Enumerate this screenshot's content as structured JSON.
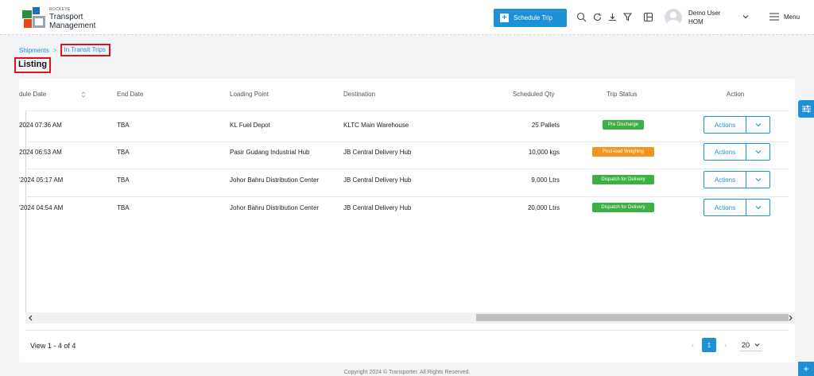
{
  "brand": {
    "small": "ROCKEYE",
    "line1": "Transport",
    "line2": "Management"
  },
  "header": {
    "schedule_label": "Schedule Trip",
    "user_name": "Demo User",
    "user_role": "HOM",
    "menu_label": "Menu"
  },
  "breadcrumb": {
    "parent": "Shipments",
    "sep": ">",
    "current": "In Transit Trips"
  },
  "page_title": "Listing",
  "table": {
    "columns": [
      "dule Date",
      "End Date",
      "Loading Point",
      "Destination",
      "Scheduled Qty",
      "Trip Status",
      "Action"
    ],
    "rows": [
      {
        "start": "2024 07:36 AM",
        "end": "TBA",
        "loading": "KL Fuel Depot",
        "destination": "KLTC Main Warehouse",
        "qty": "25 Pallets",
        "status": "Pre Discharge",
        "action": "Actions"
      },
      {
        "start": "2024 06:53 AM",
        "end": "TBA",
        "loading": "Pasir Gudang Industrial Hub",
        "destination": "JB Central Delivery Hub",
        "qty": "10,000 kgs",
        "status": "Post-load Weighing",
        "action": "Actions"
      },
      {
        "start": "'2024 05:17 AM",
        "end": "TBA",
        "loading": "Johor Bahru Distribution Center",
        "destination": "JB Central Delivery Hub",
        "qty": "9,000 Ltrs",
        "status": "Dispatch for Delivery",
        "action": "Actions"
      },
      {
        "start": "'2024 04:54 AM",
        "end": "TBA",
        "loading": "Johor Bahru Distribution Center",
        "destination": "JB Central Delivery Hub",
        "qty": "20,000 Ltrs",
        "status": "Dispatch for Delivery",
        "action": "Actions"
      }
    ]
  },
  "status_colors": {
    "Pre Discharge": "#3cb043",
    "Post-load Weighing": "#f0961e",
    "Dispatch for Delivery": "#3cb043"
  },
  "footer": {
    "view_text": "View 1 - 4 of 4",
    "page": "1",
    "page_size": "20"
  },
  "copyright": "Copyright 2024 © Transporter. All Rights Reserved."
}
